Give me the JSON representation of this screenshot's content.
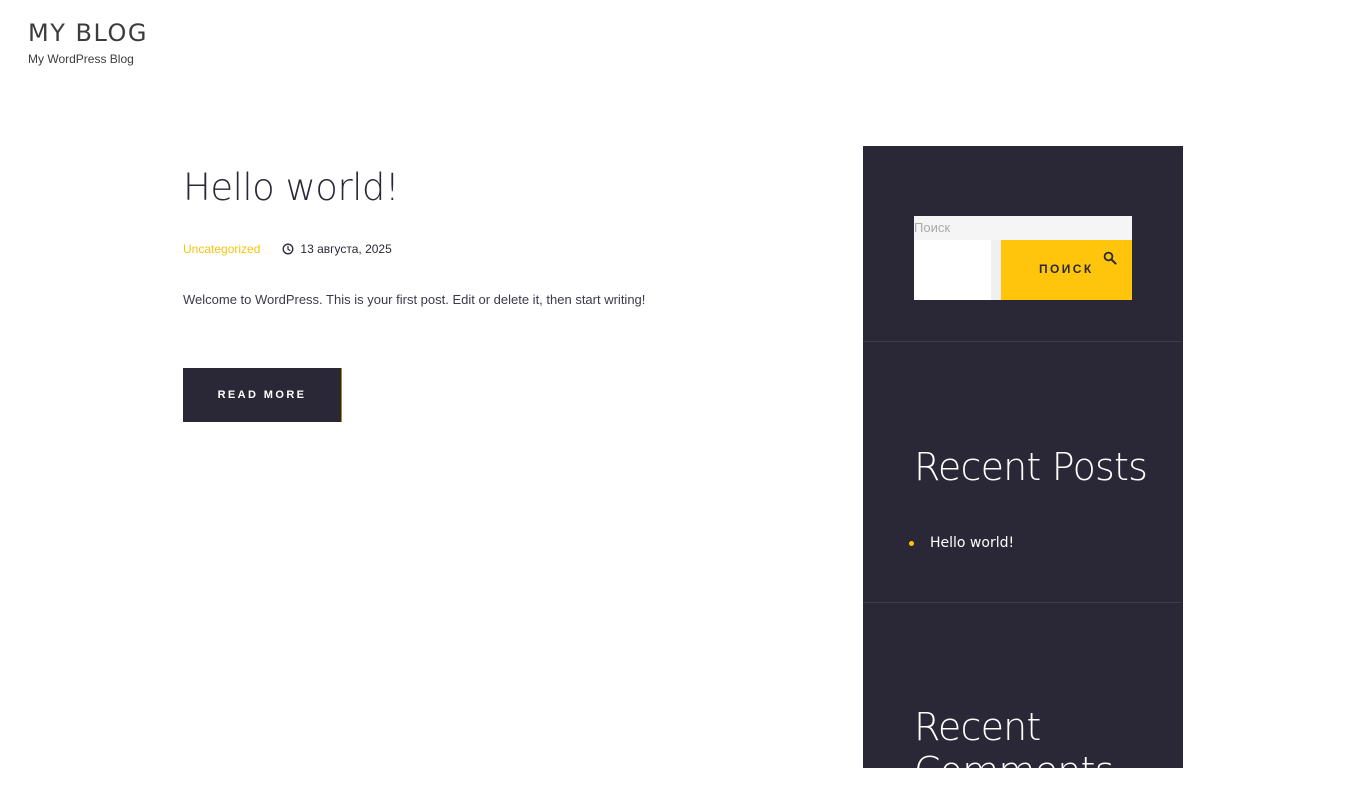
{
  "site": {
    "title": "MY BLOG",
    "tagline": "My WordPress Blog"
  },
  "post": {
    "title": "Hello world!",
    "category": "Uncategorized",
    "date": "13 августа, 2025",
    "excerpt": "Welcome to WordPress. This is your first post. Edit or delete it, then start writing!",
    "read_more_label": "READ MORE"
  },
  "sidebar": {
    "search": {
      "label": "Поиск",
      "input_value": "",
      "button_label": "ПОИСК",
      "icon": "search-icon"
    },
    "recent_posts": {
      "title": "Recent Posts",
      "items": [
        {
          "label": "Hello world!"
        }
      ]
    },
    "recent_comments": {
      "title": "Recent Comments"
    }
  },
  "colors": {
    "accent": "#fec50c",
    "dark": "#2a2837",
    "text": "#3c3c3c"
  }
}
